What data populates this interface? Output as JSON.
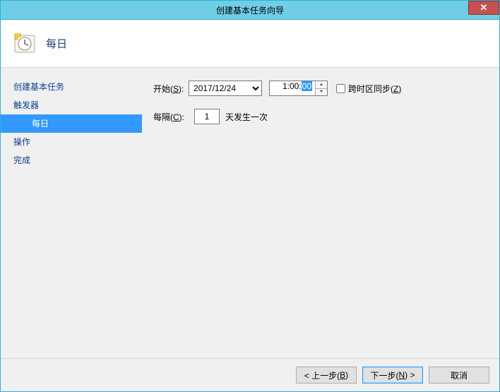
{
  "window": {
    "title": "创建基本任务向导",
    "close_glyph": "✕"
  },
  "header": {
    "title": "每日"
  },
  "sidebar": {
    "items": [
      {
        "label": "创建基本任务",
        "indent": false,
        "selected": false
      },
      {
        "label": "触发器",
        "indent": false,
        "selected": false
      },
      {
        "label": "每日",
        "indent": true,
        "selected": true
      },
      {
        "label": "操作",
        "indent": false,
        "selected": false
      },
      {
        "label": "完成",
        "indent": false,
        "selected": false
      }
    ]
  },
  "form": {
    "start_label_pre": "开始(",
    "start_label_key": "S",
    "start_label_post": "):",
    "date_value": "2017/12/24",
    "time_prefix": "1:00:",
    "time_sel": "00",
    "sync_label_pre": "跨时区同步(",
    "sync_label_key": "Z",
    "sync_label_post": ")",
    "sync_checked": false,
    "recur_label_pre": "每隔(",
    "recur_label_key": "C",
    "recur_label_post": "):",
    "recur_value": "1",
    "recur_suffix": "天发生一次"
  },
  "footer": {
    "back_pre": "< 上一步(",
    "back_key": "B",
    "back_post": ")",
    "next_pre": "下一步(",
    "next_key": "N",
    "next_post": ") >",
    "cancel": "取消"
  }
}
